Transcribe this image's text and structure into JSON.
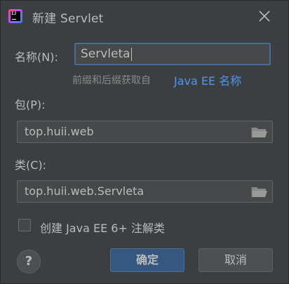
{
  "window": {
    "title": "新建 Servlet",
    "app_icon_text": "IJ",
    "close_icon": "close-icon"
  },
  "name_field": {
    "label": "名称(N):",
    "value": "Servleta"
  },
  "hint": {
    "text": "前缀和后缀获取自",
    "link": "Java EE 名称"
  },
  "package_field": {
    "label": "包(P):",
    "value": "top.huii.web",
    "icon": "folder-open-icon"
  },
  "class_field": {
    "label": "类(C):",
    "value": "top.huii.web.Servleta",
    "icon": "folder-open-icon"
  },
  "annotation_checkbox": {
    "label": "创建 Java EE 6+ 注解类",
    "checked": false
  },
  "buttons": {
    "help": "?",
    "ok": "确定",
    "cancel": "取消"
  },
  "colors": {
    "background": "#3c3f41",
    "input_background": "#45494a",
    "focus_border": "#466d94",
    "link": "#5394ec",
    "primary_button": "#365880"
  }
}
